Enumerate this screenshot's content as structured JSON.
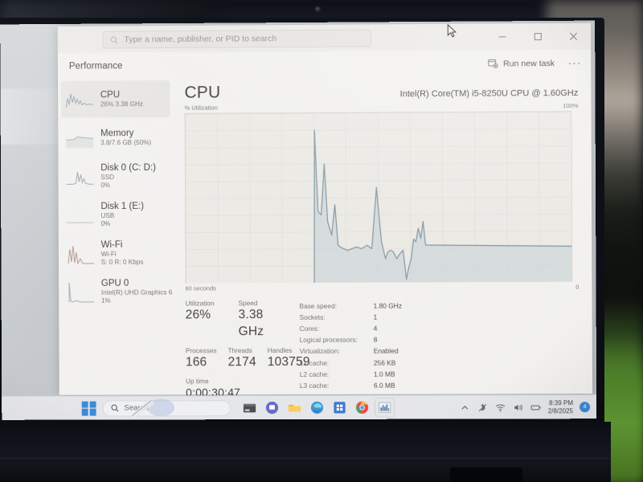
{
  "window": {
    "page_title": "Performance",
    "search_placeholder": "Type a name, publisher, or PID to search",
    "search_value": "",
    "minimize_label": "Minimize",
    "maximize_label": "Maximize",
    "close_label": "Close",
    "run_new_task_label": "Run new task",
    "more_label": "···"
  },
  "sidebar": {
    "items": [
      {
        "name": "CPU",
        "sub1": "26% 3.38 GHz",
        "sub2": "",
        "selected": true
      },
      {
        "name": "Memory",
        "sub1": "3.8/7.6 GB (50%)",
        "sub2": "",
        "selected": false
      },
      {
        "name": "Disk 0 (C: D:)",
        "sub1": "SSD",
        "sub2": "0%",
        "selected": false
      },
      {
        "name": "Disk 1 (E:)",
        "sub1": "USB",
        "sub2": "0%",
        "selected": false
      },
      {
        "name": "Wi-Fi",
        "sub1": "Wi-Fi",
        "sub2": "S: 0 R: 0 Kbps",
        "selected": false
      },
      {
        "name": "GPU 0",
        "sub1": "Intel(R) UHD Graphics 6",
        "sub2": "1%",
        "selected": false
      }
    ]
  },
  "main": {
    "title": "CPU",
    "cpu_name": "Intel(R) Core(TM) i5-8250U CPU @ 1.60GHz",
    "y_axis_label": "% Utilization",
    "y_axis_max": "100%",
    "x_axis_left": "60 seconds",
    "x_axis_right": "0"
  },
  "stats": {
    "utilization_label": "Utilization",
    "utilization_value": "26%",
    "speed_label": "Speed",
    "speed_value": "3.38 GHz",
    "processes_label": "Processes",
    "processes_value": "166",
    "threads_label": "Threads",
    "threads_value": "2174",
    "handles_label": "Handles",
    "handles_value": "103759",
    "uptime_label": "Up time",
    "uptime_value": "0:00:30:47"
  },
  "details": [
    {
      "key": "Base speed:",
      "value": "1.80 GHz"
    },
    {
      "key": "Sockets:",
      "value": "1"
    },
    {
      "key": "Cores:",
      "value": "4"
    },
    {
      "key": "Logical processors:",
      "value": "8"
    },
    {
      "key": "Virtualization:",
      "value": "Enabled"
    },
    {
      "key": "L1 cache:",
      "value": "256 KB"
    },
    {
      "key": "L2 cache:",
      "value": "1.0 MB"
    },
    {
      "key": "L3 cache:",
      "value": "6.0 MB"
    }
  ],
  "taskbar": {
    "search_label": "Search",
    "time": "8:39 PM",
    "date": "2/8/2025",
    "badge_count": "4"
  },
  "colors": {
    "accent": "#2b7fd4",
    "graph_line": "#7f97a3",
    "graph_fill": "#c6d2d6",
    "window_bg": "#f3f2f0",
    "selected_item": "#e7e5e1"
  },
  "chart_data": {
    "type": "area",
    "title": "CPU % Utilization",
    "xlabel": "60 seconds",
    "ylabel": "% Utilization",
    "ylim": [
      0,
      100
    ],
    "xlim": [
      0,
      60
    ],
    "grid": true,
    "series": [
      {
        "name": "% Utilization",
        "note": "Data begins ~32% into the 60-second window; left portion has no samples yet.",
        "x": [
          32.0,
          32.2,
          33.0,
          33.6,
          34.4,
          35.2,
          36.2,
          37.0,
          37.8,
          38.4,
          39.2,
          40.2,
          41.2,
          42.4,
          43.6,
          45.0,
          46.2,
          47.4,
          48.6,
          49.6,
          50.2,
          50.8,
          51.6,
          52.4,
          53.2,
          54.0,
          54.8,
          55.4,
          56.0,
          56.6,
          57.2,
          57.8,
          58.4,
          59.0,
          59.6,
          60.0
        ],
        "values": [
          0,
          90,
          42,
          40,
          70,
          36,
          28,
          46,
          22,
          21,
          20,
          19,
          20,
          21,
          20,
          22,
          20,
          56,
          24,
          14,
          18,
          19,
          18,
          13,
          17,
          19,
          2,
          9,
          14,
          26,
          24,
          32,
          26,
          36,
          22,
          21
        ]
      }
    ]
  }
}
